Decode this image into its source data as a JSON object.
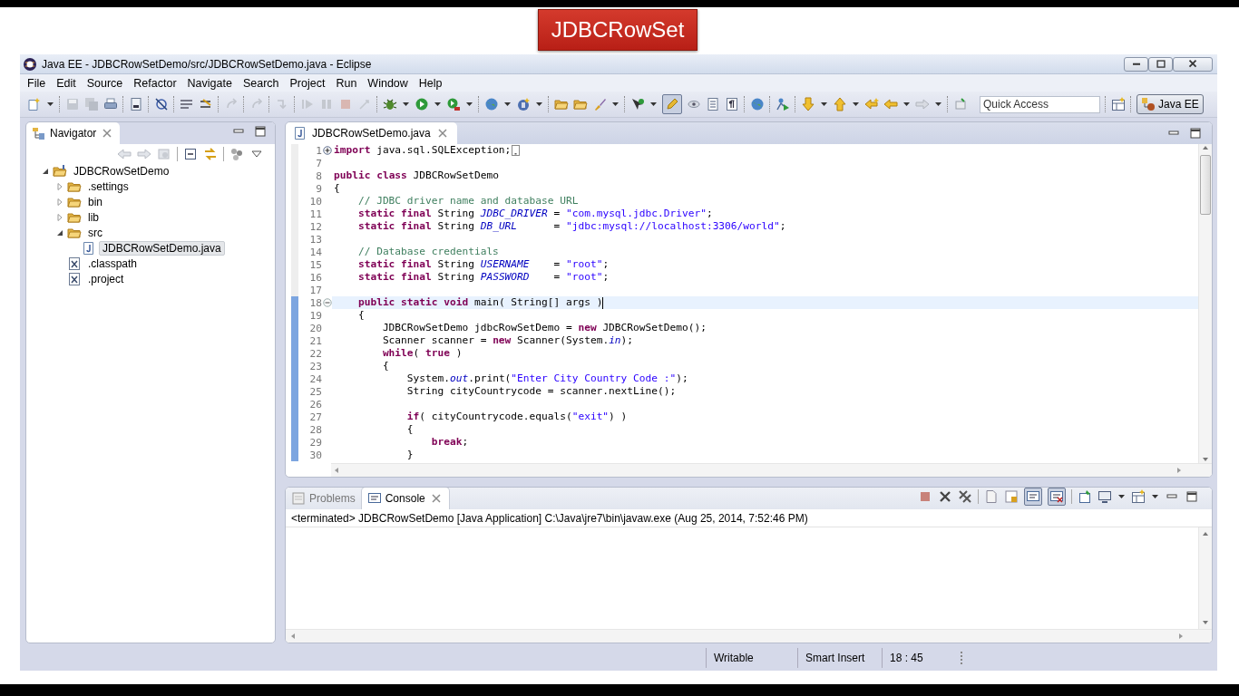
{
  "banner": {
    "title": "JDBCRowSet"
  },
  "window": {
    "title": "Java EE - JDBCRowSetDemo/src/JDBCRowSetDemo.java - Eclipse"
  },
  "menu": [
    "File",
    "Edit",
    "Source",
    "Refactor",
    "Navigate",
    "Search",
    "Project",
    "Run",
    "Window",
    "Help"
  ],
  "toolbar": {
    "quick_access": {
      "placeholder": "Quick Access"
    },
    "perspective": {
      "label": "Java EE",
      "selected": true
    }
  },
  "navigator": {
    "tab": {
      "label": "Navigator"
    },
    "tree": [
      {
        "label": "JDBCRowSetDemo",
        "kind": "project",
        "expanded": true,
        "selected": false,
        "children": [
          {
            "label": ".settings",
            "kind": "folder",
            "expanded": false,
            "selected": false
          },
          {
            "label": "bin",
            "kind": "folder",
            "expanded": false,
            "selected": false
          },
          {
            "label": "lib",
            "kind": "folder",
            "expanded": false,
            "selected": false
          },
          {
            "label": "src",
            "kind": "folder",
            "expanded": true,
            "selected": false,
            "children": [
              {
                "label": "JDBCRowSetDemo.java",
                "kind": "java",
                "selected": true
              }
            ]
          },
          {
            "label": ".classpath",
            "kind": "xml",
            "selected": false
          },
          {
            "label": ".project",
            "kind": "xml",
            "selected": false
          }
        ]
      }
    ]
  },
  "editor": {
    "tab": {
      "label": "JDBCRowSetDemo.java"
    },
    "lines": [
      {
        "number": "1",
        "kind": "folded",
        "in_range": false,
        "current": false,
        "tokens": [
          {
            "kind": "keyword",
            "text": "import"
          },
          {
            "kind": "plain",
            "text": " java.sql.SQLException;"
          }
        ]
      },
      {
        "number": "7",
        "kind": "plain",
        "in_range": false,
        "current": false
      },
      {
        "number": "8",
        "kind": "plain",
        "in_range": false,
        "current": false,
        "tokens": [
          {
            "kind": "keyword",
            "text": "public"
          },
          {
            "kind": "keyword",
            "text": " class"
          },
          {
            "kind": "plain",
            "text": " JDBCRowSetDemo"
          }
        ]
      },
      {
        "number": "9",
        "kind": "plain",
        "in_range": false,
        "current": false,
        "tokens": [
          {
            "kind": "plain",
            "text": "{"
          }
        ]
      },
      {
        "number": "10",
        "kind": "plain",
        "in_range": false,
        "current": false,
        "tokens": [
          {
            "kind": "comment",
            "text": "    // JDBC driver name and database URL"
          }
        ]
      },
      {
        "number": "11",
        "kind": "plain",
        "in_range": false,
        "current": false,
        "tokens": [
          {
            "kind": "keyword",
            "text": "    static"
          },
          {
            "kind": "keyword",
            "text": " final"
          },
          {
            "kind": "plain",
            "text": " String "
          },
          {
            "kind": "field",
            "text": "JDBC_DRIVER"
          },
          {
            "kind": "plain",
            "text": " = "
          },
          {
            "kind": "string",
            "text": "\"com.mysql.jdbc.Driver\""
          },
          {
            "kind": "plain",
            "text": ";"
          }
        ]
      },
      {
        "number": "12",
        "kind": "plain",
        "in_range": false,
        "current": false,
        "tokens": [
          {
            "kind": "keyword",
            "text": "    static"
          },
          {
            "kind": "keyword",
            "text": " final"
          },
          {
            "kind": "plain",
            "text": " String "
          },
          {
            "kind": "field",
            "text": "DB_URL"
          },
          {
            "kind": "plain",
            "text": "      = "
          },
          {
            "kind": "string",
            "text": "\"jdbc:mysql://localhost:3306/world\""
          },
          {
            "kind": "plain",
            "text": ";"
          }
        ]
      },
      {
        "number": "13",
        "kind": "plain",
        "in_range": false,
        "current": false
      },
      {
        "number": "14",
        "kind": "plain",
        "in_range": false,
        "current": false,
        "tokens": [
          {
            "kind": "comment",
            "text": "    // Database credentials"
          }
        ]
      },
      {
        "number": "15",
        "kind": "plain",
        "in_range": false,
        "current": false,
        "tokens": [
          {
            "kind": "keyword",
            "text": "    static"
          },
          {
            "kind": "keyword",
            "text": " final"
          },
          {
            "kind": "plain",
            "text": " String "
          },
          {
            "kind": "field",
            "text": "USERNAME"
          },
          {
            "kind": "plain",
            "text": "    = "
          },
          {
            "kind": "string",
            "text": "\"root\""
          },
          {
            "kind": "plain",
            "text": ";"
          }
        ]
      },
      {
        "number": "16",
        "kind": "plain",
        "in_range": false,
        "current": false,
        "tokens": [
          {
            "kind": "keyword",
            "text": "    static"
          },
          {
            "kind": "keyword",
            "text": " final"
          },
          {
            "kind": "plain",
            "text": " String "
          },
          {
            "kind": "field",
            "text": "PASSWORD"
          },
          {
            "kind": "plain",
            "text": "    = "
          },
          {
            "kind": "string",
            "text": "\"root\""
          },
          {
            "kind": "plain",
            "text": ";"
          }
        ]
      },
      {
        "number": "17",
        "kind": "plain",
        "in_range": false,
        "current": false
      },
      {
        "number": "18",
        "kind": "foldable",
        "in_range": true,
        "current": true,
        "tokens": [
          {
            "kind": "keyword",
            "text": "    public"
          },
          {
            "kind": "keyword",
            "text": " static"
          },
          {
            "kind": "keyword",
            "text": " void"
          },
          {
            "kind": "plain",
            "text": " main( String[] args )"
          }
        ]
      },
      {
        "number": "19",
        "kind": "plain",
        "in_range": true,
        "current": false,
        "tokens": [
          {
            "kind": "plain",
            "text": "    {"
          }
        ]
      },
      {
        "number": "20",
        "kind": "plain",
        "in_range": true,
        "current": false,
        "tokens": [
          {
            "kind": "plain",
            "text": "        JDBCRowSetDemo jdbcRowSetDemo = "
          },
          {
            "kind": "keyword",
            "text": "new"
          },
          {
            "kind": "plain",
            "text": " JDBCRowSetDemo();"
          }
        ]
      },
      {
        "number": "21",
        "kind": "plain",
        "in_range": true,
        "current": false,
        "tokens": [
          {
            "kind": "plain",
            "text": "        Scanner scanner = "
          },
          {
            "kind": "keyword",
            "text": "new"
          },
          {
            "kind": "plain",
            "text": " Scanner(System."
          },
          {
            "kind": "field",
            "text": "in"
          },
          {
            "kind": "plain",
            "text": ");"
          }
        ]
      },
      {
        "number": "22",
        "kind": "plain",
        "in_range": true,
        "current": false,
        "tokens": [
          {
            "kind": "keyword",
            "text": "        while"
          },
          {
            "kind": "plain",
            "text": "( "
          },
          {
            "kind": "keyword",
            "text": "true"
          },
          {
            "kind": "plain",
            "text": " )"
          }
        ]
      },
      {
        "number": "23",
        "kind": "plain",
        "in_range": true,
        "current": false,
        "tokens": [
          {
            "kind": "plain",
            "text": "        {"
          }
        ]
      },
      {
        "number": "24",
        "kind": "plain",
        "in_range": true,
        "current": false,
        "tokens": [
          {
            "kind": "plain",
            "text": "            System."
          },
          {
            "kind": "field",
            "text": "out"
          },
          {
            "kind": "plain",
            "text": ".print("
          },
          {
            "kind": "string",
            "text": "\"Enter City Country Code :\""
          },
          {
            "kind": "plain",
            "text": ");"
          }
        ]
      },
      {
        "number": "25",
        "kind": "plain",
        "in_range": true,
        "current": false,
        "tokens": [
          {
            "kind": "plain",
            "text": "            String cityCountrycode = scanner.nextLine();"
          }
        ]
      },
      {
        "number": "26",
        "kind": "plain",
        "in_range": true,
        "current": false
      },
      {
        "number": "27",
        "kind": "plain",
        "in_range": true,
        "current": false,
        "tokens": [
          {
            "kind": "keyword",
            "text": "            if"
          },
          {
            "kind": "plain",
            "text": "( cityCountrycode.equals("
          },
          {
            "kind": "string",
            "text": "\"exit\""
          },
          {
            "kind": "plain",
            "text": ") )"
          }
        ]
      },
      {
        "number": "28",
        "kind": "plain",
        "in_range": true,
        "current": false,
        "tokens": [
          {
            "kind": "plain",
            "text": "            {"
          }
        ]
      },
      {
        "number": "29",
        "kind": "plain",
        "in_range": true,
        "current": false,
        "tokens": [
          {
            "kind": "keyword",
            "text": "                break"
          },
          {
            "kind": "plain",
            "text": ";"
          }
        ]
      },
      {
        "number": "30",
        "kind": "plain",
        "in_range": true,
        "current": false,
        "tokens": [
          {
            "kind": "plain",
            "text": "            }"
          }
        ]
      }
    ]
  },
  "console": {
    "tabs": [
      {
        "label": "Problems",
        "selected": false
      },
      {
        "label": "Console",
        "selected": true
      }
    ],
    "status_line": "<terminated> JDBCRowSetDemo [Java Application] C:\\Java\\jre7\\bin\\javaw.exe (Aug 25, 2014, 7:52:46 PM)"
  },
  "status_bar": [
    "Writable",
    "Smart Insert",
    "18 : 45"
  ]
}
